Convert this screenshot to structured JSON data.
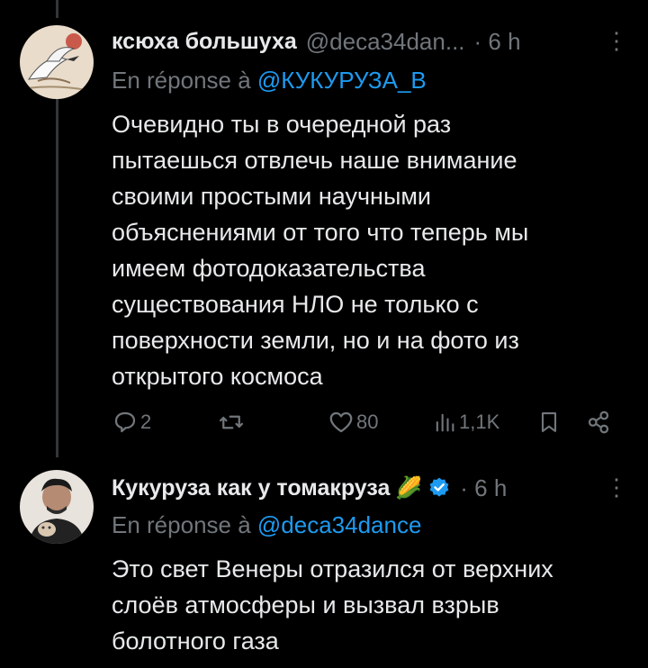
{
  "tweet1": {
    "name": "ксюха большуха",
    "handle": "@deca34dan...",
    "time": "· 6 h",
    "more": "⋮",
    "reply_prefix": "En réponse à ",
    "reply_mention": "@КУКУРУЗА_В",
    "text_lines": [
      "Очевидно ты в очередной раз",
      "пытаешься отвлечь наше внимание",
      "своими простыми научными",
      "объяснениями от того что теперь мы",
      "имеем фотодоказательства",
      "существования НЛО не только с",
      "поверхности земли, но и на фото из",
      "открытого космоса"
    ],
    "actions": {
      "replies": "2",
      "reposts": "",
      "likes": "80",
      "views": "1,1K"
    }
  },
  "tweet2": {
    "name": "Кукуруза как у томакруза",
    "emoji": "🌽",
    "time": "· 6 h",
    "more": "⋮",
    "reply_prefix": "En réponse à ",
    "reply_mention": "@deca34dance",
    "text_lines": [
      "Это свет Венеры отразился от верхних",
      "слоёв атмосферы и вызвал взрыв",
      "болотного газа"
    ]
  },
  "icons": {
    "reply": "reply-icon",
    "repost": "repost-icon",
    "like": "heart-icon",
    "views": "views-icon",
    "bookmark": "bookmark-icon",
    "share": "share-icon",
    "verified": "verified-badge-icon"
  },
  "colors": {
    "background": "#000000",
    "text": "#e7e9ea",
    "secondary": "#71767b",
    "link": "#1d9bf0"
  }
}
